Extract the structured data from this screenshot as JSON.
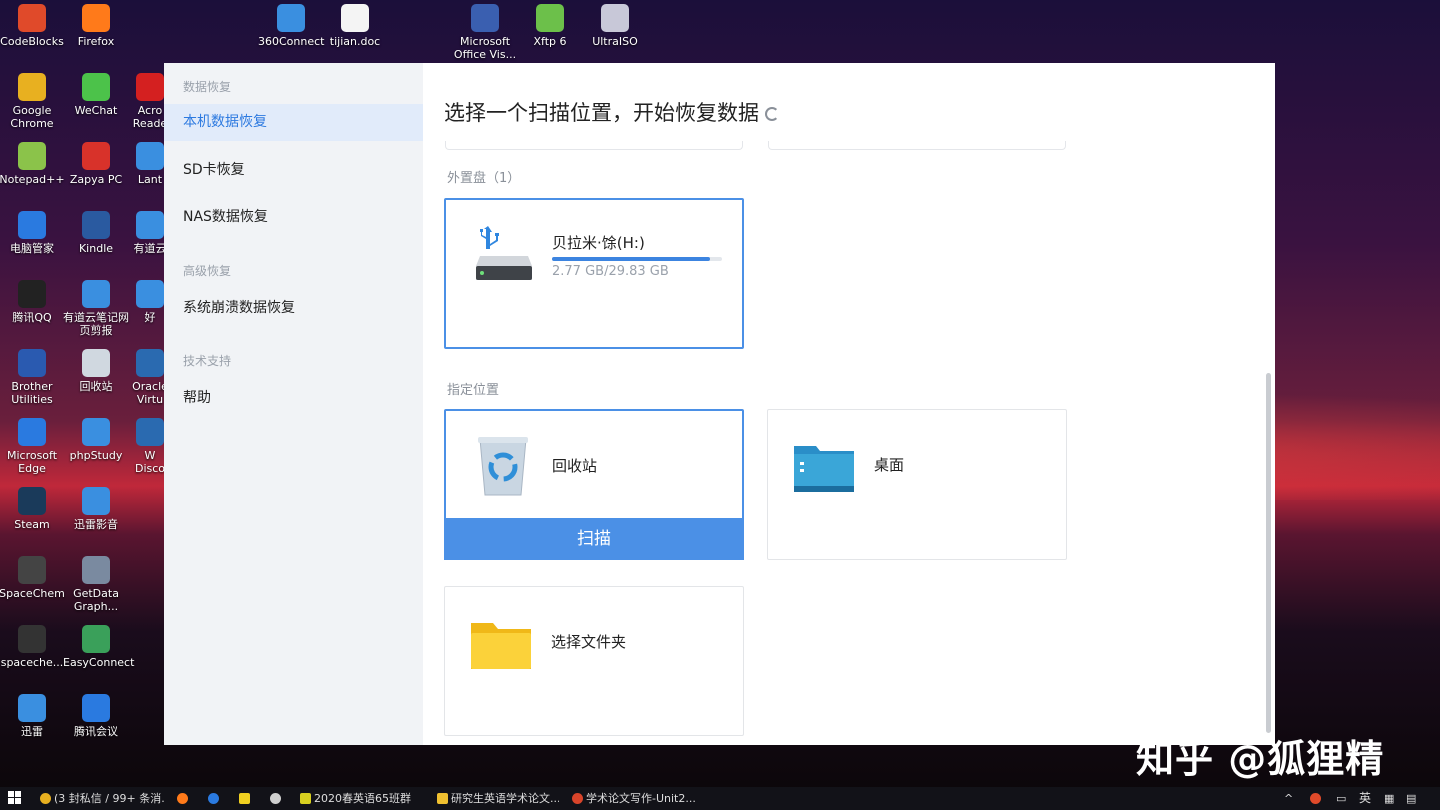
{
  "desktop": {
    "icons": [
      {
        "label": "CodeBlocks",
        "color": "#e04a2a"
      },
      {
        "label": "Firefox",
        "color": "#ff7a1a"
      },
      {
        "label": "360Connect",
        "color": "#3a8fe0"
      },
      {
        "label": "tijian.doc",
        "color": "#f4f4f4"
      },
      {
        "label": "Microsoft\nOffice Vis...",
        "color": "#3a5fb0"
      },
      {
        "label": "Xftp 6",
        "color": "#6cc04a"
      },
      {
        "label": "UltraISO",
        "color": "#c8c8d8"
      },
      {
        "label": "Google\nChrome",
        "color": "#e8b020"
      },
      {
        "label": "WeChat",
        "color": "#4cc24a"
      },
      {
        "label": "Acro\nReade",
        "color": "#d42020"
      },
      {
        "label": "Notepad++",
        "color": "#8bc34a"
      },
      {
        "label": "Zapya PC",
        "color": "#d8322a"
      },
      {
        "label": "Lant",
        "color": "#3a8fe0"
      },
      {
        "label": "电脑管家",
        "color": "#2a7ae0"
      },
      {
        "label": "Kindle",
        "color": "#2a5aa0"
      },
      {
        "label": "有道云",
        "color": "#3a8fe0"
      },
      {
        "label": "腾讯QQ",
        "color": "#222222"
      },
      {
        "label": "有道云笔记网\n页剪报",
        "color": "#3a8fe0"
      },
      {
        "label": "好",
        "color": "#3a8fe0"
      },
      {
        "label": "Brother\nUtilities",
        "color": "#2a5ab0"
      },
      {
        "label": "回收站",
        "color": "#d0d8e0"
      },
      {
        "label": "Oracle\nVirtu",
        "color": "#2a6ab0"
      },
      {
        "label": "Microsoft\nEdge",
        "color": "#2a7ae0"
      },
      {
        "label": "phpStudy",
        "color": "#3a8fe0"
      },
      {
        "label": "W\nDisco",
        "color": "#2a6ab0"
      },
      {
        "label": "Steam",
        "color": "#1a3a5a"
      },
      {
        "label": "迅雷影音",
        "color": "#3a8fe0"
      },
      {
        "label": "SpaceChem",
        "color": "#444444"
      },
      {
        "label": "GetData\nGraph...",
        "color": "#7a8aa0"
      },
      {
        "label": "spaceche...",
        "color": "#333333"
      },
      {
        "label": "EasyConnect",
        "color": "#3aa05a"
      },
      {
        "label": "迅雷",
        "color": "#3a8fe0"
      },
      {
        "label": "腾讯会议",
        "color": "#2a7ae0"
      }
    ]
  },
  "sidebar": {
    "section1": "数据恢复",
    "item_local": "本机数据恢复",
    "item_sd": "SD卡恢复",
    "item_nas": "NAS数据恢复",
    "section2": "高级恢复",
    "item_crash": "系统崩溃数据恢复",
    "section3": "技术支持",
    "item_help": "帮助"
  },
  "main": {
    "title": "选择一个扫描位置，开始恢复数据",
    "external_group": "外置盘（1）",
    "drive_name": "贝拉米·馀(H:)",
    "drive_size": "2.77 GB/29.83 GB",
    "drive_used_fraction": 0.93,
    "location_group": "指定位置",
    "recycle_label": "回收站",
    "scan_label": "扫描",
    "desktop_label": "桌面",
    "folder_label": "选择文件夹"
  },
  "taskbar": {
    "item1": "(3 封私信 / 99+ 条消...",
    "item2": "2020春英语65班群",
    "item3": "研究生英语学术论文...",
    "item4": "学术论文写作-Unit2....",
    "ime": "英"
  },
  "watermark": "知乎 @狐狸精"
}
